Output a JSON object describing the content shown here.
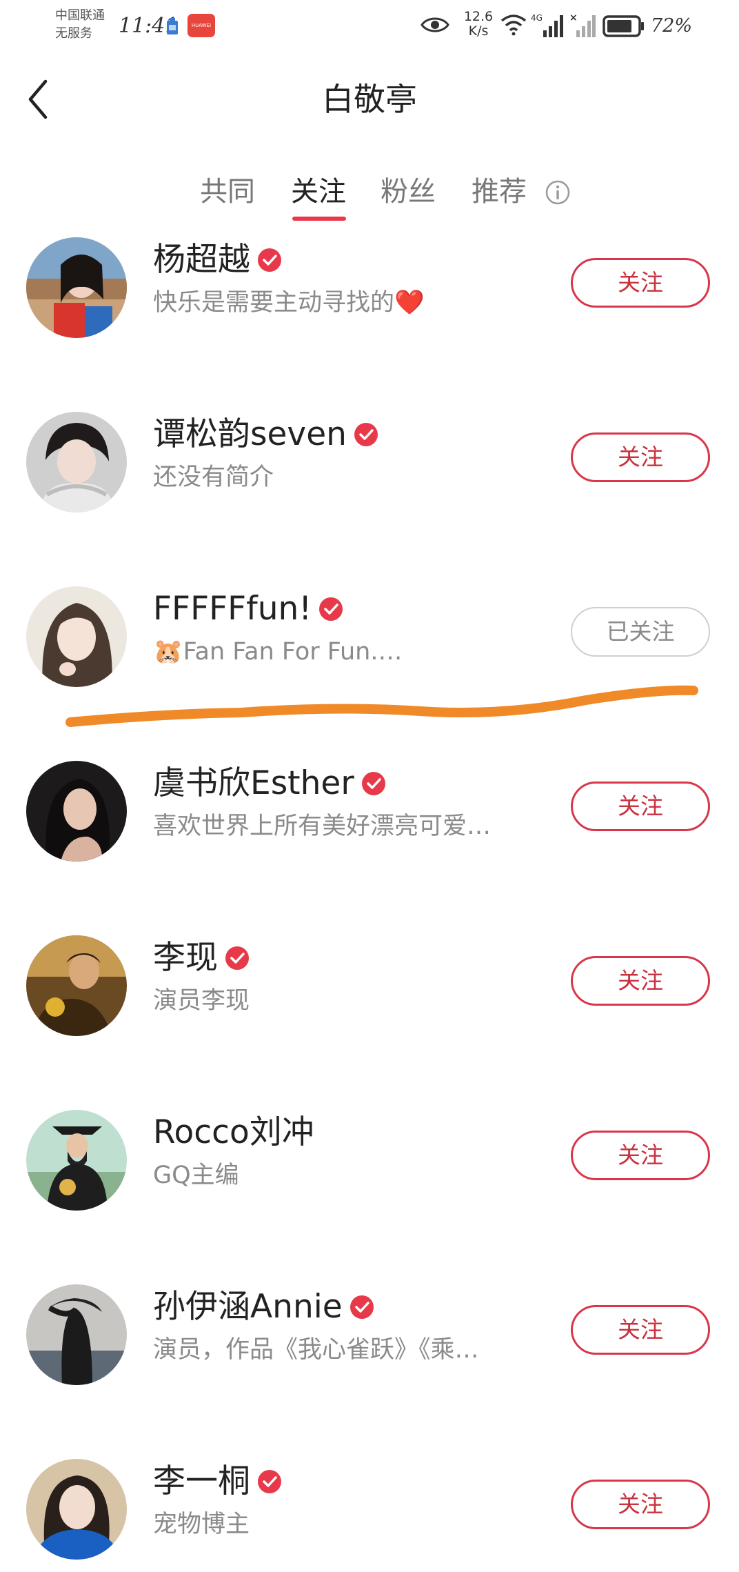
{
  "status_bar": {
    "carrier_line1": "中国联通",
    "carrier_line2": "无服务",
    "time": "11:41",
    "app_badge": "HUAWEI",
    "net_speed_value": "12.6",
    "net_speed_unit": "K/s",
    "battery": "72%"
  },
  "header": {
    "title": "白敬亭",
    "back_icon": "chevron-left-icon"
  },
  "tabs": [
    {
      "label": "共同",
      "active": false
    },
    {
      "label": "关注",
      "active": true
    },
    {
      "label": "粉丝",
      "active": false
    },
    {
      "label": "推荐",
      "active": false
    }
  ],
  "users": [
    {
      "name": "杨超越",
      "verified": true,
      "bio": "快乐是需要主动寻找的❤️",
      "button": "关注",
      "followed": false
    },
    {
      "name": "谭松韵seven",
      "verified": true,
      "bio": "还没有简介",
      "button": "关注",
      "followed": false
    },
    {
      "name": "FFFFFfun!",
      "verified": true,
      "bio": "🐹Fan Fan For Fun.…",
      "button": "已关注",
      "followed": true
    },
    {
      "name": "虞书欣Esther",
      "verified": true,
      "bio": "喜欢世界上所有美好漂亮可爱…",
      "button": "关注",
      "followed": false
    },
    {
      "name": "李现",
      "verified": true,
      "bio": "演员李现",
      "button": "关注",
      "followed": false
    },
    {
      "name": "Rocco刘冲",
      "verified": false,
      "bio": "GQ主编",
      "button": "关注",
      "followed": false
    },
    {
      "name": "孙伊涵Annie",
      "verified": true,
      "bio": "演员，作品《我心雀跃》《乘…",
      "button": "关注",
      "followed": false
    },
    {
      "name": "李一桐",
      "verified": true,
      "bio": "宠物博主",
      "button": "关注",
      "followed": false
    }
  ],
  "colors": {
    "accent": "#e8394a",
    "button_text": "#c8323f",
    "muted_text": "#8a8a8a",
    "annotation": "#f08a28"
  }
}
